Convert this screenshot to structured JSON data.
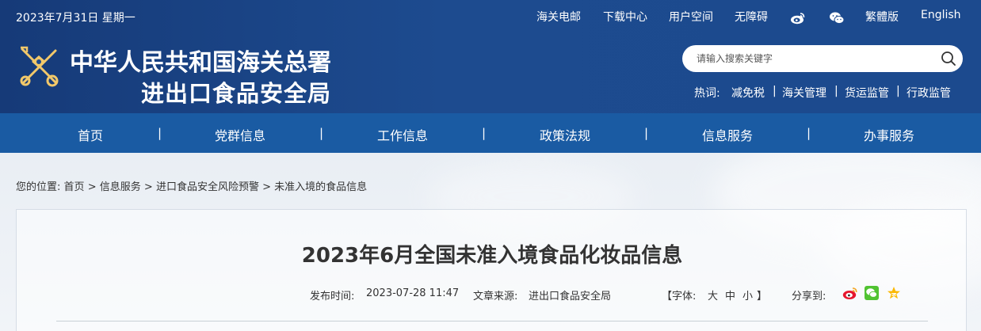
{
  "header": {
    "date": "2023年7月31日 星期一",
    "top_links": [
      "海关电邮",
      "下载中心",
      "用户空间",
      "无障碍",
      "繁體版",
      "English"
    ],
    "icons": [
      "weibo-icon",
      "wechat-icon"
    ],
    "title_line1": "中华人民共和国海关总署",
    "title_line2": "进出口食品安全局",
    "search": {
      "placeholder": "请输入搜索关键字"
    },
    "hot_label": "热词:",
    "hot_words": [
      "减免税",
      "海关管理",
      "货运监管",
      "行政监管"
    ]
  },
  "nav": {
    "items": [
      "首页",
      "党群信息",
      "工作信息",
      "政策法规",
      "信息服务",
      "办事服务"
    ],
    "separator": "|"
  },
  "breadcrumb": {
    "label": "您的位置:",
    "items": [
      "首页",
      "信息服务",
      "进口食品安全风险预警",
      "未准入境的食品信息"
    ],
    "separator": ">"
  },
  "article": {
    "title": "2023年6月全国未准入境食品化妆品信息",
    "publish_label": "发布时间:",
    "publish_time": "2023-07-28 11:47",
    "source_label": "文章来源:",
    "source": "进出口食品安全局",
    "font_label": "【字体:",
    "font_sizes": [
      "大",
      "中",
      "小"
    ],
    "font_close": "】",
    "share_label": "分享到:",
    "share_icons": [
      "weibo-share-icon",
      "wechat-share-icon",
      "qzone-share-icon"
    ]
  },
  "colors": {
    "header_bg": "#1d4b8f",
    "nav_bg": "#1a5ba3",
    "page_bg": "#eef2f6"
  }
}
